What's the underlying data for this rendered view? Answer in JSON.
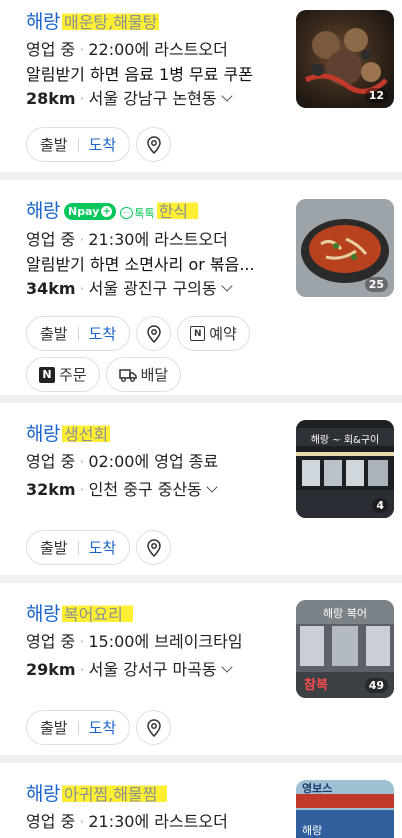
{
  "places": [
    {
      "name": "해랑",
      "category": "매운탕,해물탕",
      "status_open": "영업 중",
      "status_detail": "22:00에 라스트오더",
      "desc": "알림받기 하면 음료 1병 무료 쿠폰",
      "distance": "28km",
      "address": "서울 강남구 논현동",
      "photo_count": "12",
      "actions": {
        "depart": "출발",
        "arrive": "도착"
      }
    },
    {
      "name": "해랑",
      "category": "한식",
      "npay_label": "pay",
      "talk_label": "톡톡",
      "status_open": "영업 중",
      "status_detail": "21:30에 라스트오더",
      "desc": "알림받기 하면 소면사리 or 볶음...",
      "distance": "34km",
      "address": "서울 광진구 구의동",
      "photo_count": "25",
      "actions": {
        "depart": "출발",
        "arrive": "도착",
        "reserve": "예약",
        "order": "주문",
        "delivery": "배달"
      }
    },
    {
      "name": "해랑",
      "category": "생선회",
      "status_open": "영업 중",
      "status_detail": "02:00에 영업 종료",
      "distance": "32km",
      "address": "인천 중구 중산동",
      "photo_count": "4",
      "photo_sign": "해랑 ~ 회&구이",
      "actions": {
        "depart": "출발",
        "arrive": "도착"
      }
    },
    {
      "name": "해랑",
      "category": "복어요리",
      "status_open": "영업 중",
      "status_detail": "15:00에 브레이크타임",
      "distance": "29km",
      "address": "서울 강서구 마곡동",
      "photo_count": "49",
      "photo_sign": "해랑 복어",
      "photo_sign2": "참복",
      "actions": {
        "depart": "출발",
        "arrive": "도착"
      }
    },
    {
      "name": "해랑",
      "category": "아귀찜,해물찜",
      "status_open": "영업 중",
      "status_detail": "21:30에 라스트오더",
      "photo_sign": "영보스",
      "photo_sign2": "해랑"
    }
  ],
  "colors": {
    "link": "#1b64c8",
    "highlight": "#ffef33",
    "naver_green": "#03c75a"
  },
  "icons": {
    "pin": "map-pin-icon",
    "chevron": "chevron-down-icon",
    "reserve": "calendar-n-icon",
    "order": "naver-n-icon",
    "delivery": "delivery-truck-icon"
  }
}
